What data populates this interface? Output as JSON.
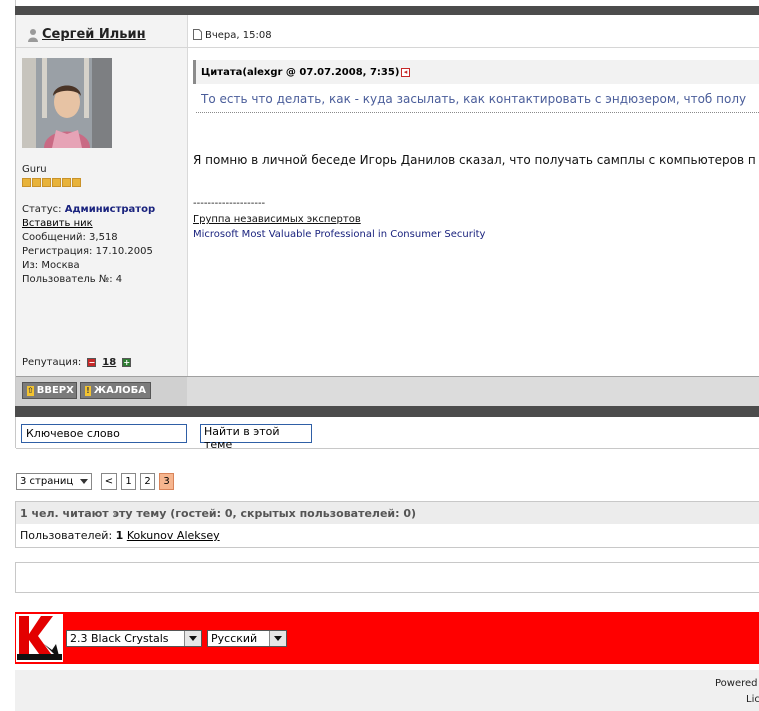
{
  "post": {
    "author": "Сергей Ильин",
    "date": "Вчера, 15:08",
    "rank": "Guru",
    "stars": 6,
    "status_label": "Статус:",
    "status_value": "Администратор",
    "insert_nick": "Вставить ник",
    "messages": "Сообщений: 3,518",
    "registered": "Регистрация: 17.10.2005",
    "from": "Из: Москва",
    "user_no": "Пользователь №: 4",
    "reputation_label": "Репутация:",
    "reputation_value": "18",
    "quote_title": "Цитата(alexgr @ 07.07.2008, 7:35)",
    "quote_text": "То есть что делать, как - куда засылать, как контактировать с эндюзером, чтоб полу",
    "body_text": "Я помню в личной беседе Игорь Данилов сказал, что получать самплы с компьютеров п",
    "signature_line": "--------------------",
    "signature_group": "Группа независимых экспертов",
    "signature_mvp": "Microsoft Most Valuable Professional in Consumer Security",
    "buttons": {
      "up": "ВВЕРХ",
      "report": "ЖАЛОБА"
    }
  },
  "search": {
    "keyword_value": "Ключевое слово",
    "find_button": "Найти в этой теме"
  },
  "pagination": {
    "pages_label": "3 страниц",
    "prev": "<",
    "pages": [
      "1",
      "2",
      "3"
    ],
    "current": "3"
  },
  "readers": {
    "title": "1 чел. читают эту тему (гостей: 0, скрытых пользователей: 0)",
    "users_label": "Пользователей:",
    "users_count": "1",
    "user_name": "Kokunov Aleksey"
  },
  "skin": {
    "skin_value": "2.3 Black Crystals",
    "language_value": "Русский"
  },
  "footer": {
    "powered": "Powered",
    "lic": "Lic"
  },
  "colors": {
    "dark_bar": "#4c4c4c",
    "skin_bar": "#ff0000",
    "current_page": "#f6b58e",
    "admin": "#1a237e"
  }
}
